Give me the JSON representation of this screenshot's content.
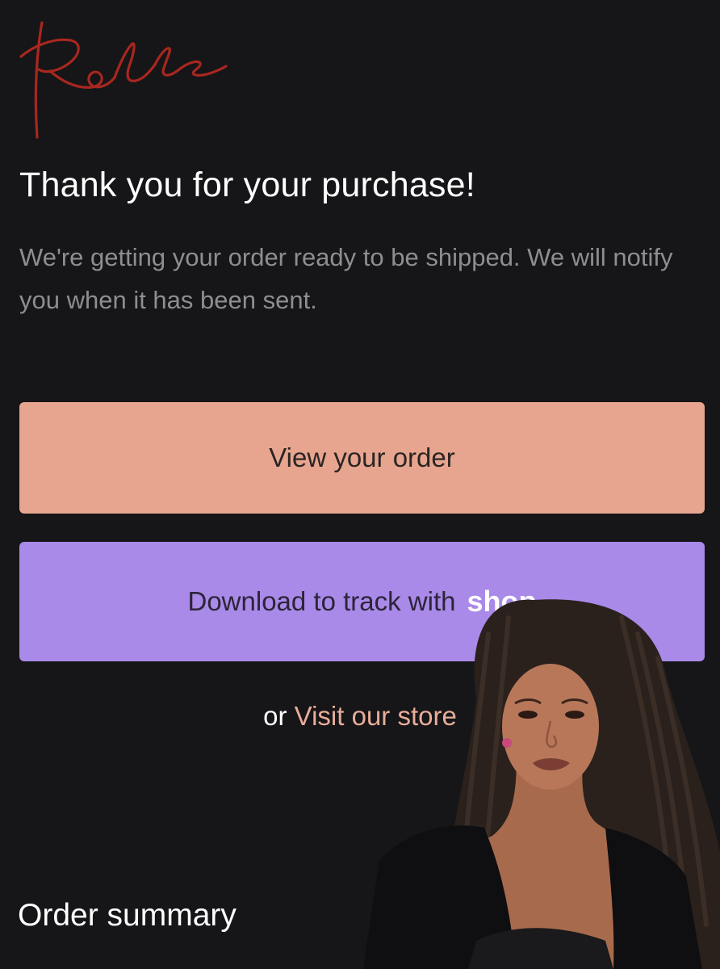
{
  "header": {
    "logo_signature": "Halle"
  },
  "confirmation": {
    "title": "Thank you for your purchase!",
    "message": "We're getting your order ready to be shipped. We will notify you when it has been sent."
  },
  "actions": {
    "view_order_label": "View your order",
    "track_label": "Download to track with",
    "shop_wordmark": "shop",
    "visit_prefix": "or",
    "visit_store_label": "Visit our store"
  },
  "summary": {
    "title": "Order summary"
  },
  "colors": {
    "background": "#161517",
    "primary_button": "#e7a590",
    "shop_button": "#a98ae9",
    "link": "#e8ad99",
    "logo": "#a8271f"
  }
}
